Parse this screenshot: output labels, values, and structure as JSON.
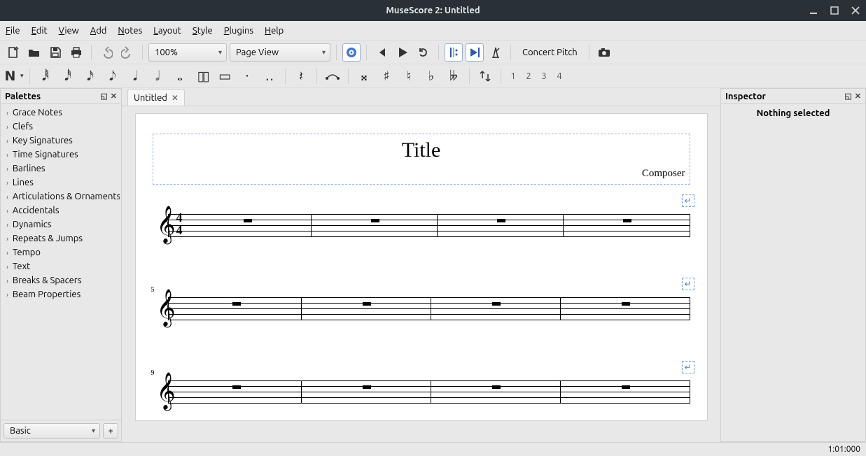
{
  "window": {
    "title": "MuseScore 2: Untitled"
  },
  "menubar": [
    "File",
    "Edit",
    "View",
    "Add",
    "Notes",
    "Layout",
    "Style",
    "Plugins",
    "Help"
  ],
  "toolbar1": {
    "zoom": "100%",
    "view": "Page View",
    "concert_pitch": "Concert Pitch"
  },
  "note_toolbar": {
    "voice_numbers": [
      "1",
      "2",
      "3",
      "4"
    ]
  },
  "palettes": {
    "title": "Palettes",
    "items": [
      "Grace Notes",
      "Clefs",
      "Key Signatures",
      "Time Signatures",
      "Barlines",
      "Lines",
      "Articulations & Ornaments",
      "Accidentals",
      "Dynamics",
      "Repeats & Jumps",
      "Tempo",
      "Text",
      "Breaks & Spacers",
      "Beam Properties"
    ],
    "workspace": "Basic",
    "add_label": "+"
  },
  "tabs": [
    {
      "label": "Untitled"
    }
  ],
  "score": {
    "title": "Title",
    "composer": "Composer",
    "time_sig_num": "4",
    "time_sig_den": "4",
    "systems": [
      {
        "measure_label": "",
        "measures": 4
      },
      {
        "measure_label": "5",
        "measures": 4
      },
      {
        "measure_label": "9",
        "measures": 4
      }
    ]
  },
  "inspector": {
    "title": "Inspector",
    "empty": "Nothing selected"
  },
  "status": {
    "position": "1:01:000"
  }
}
